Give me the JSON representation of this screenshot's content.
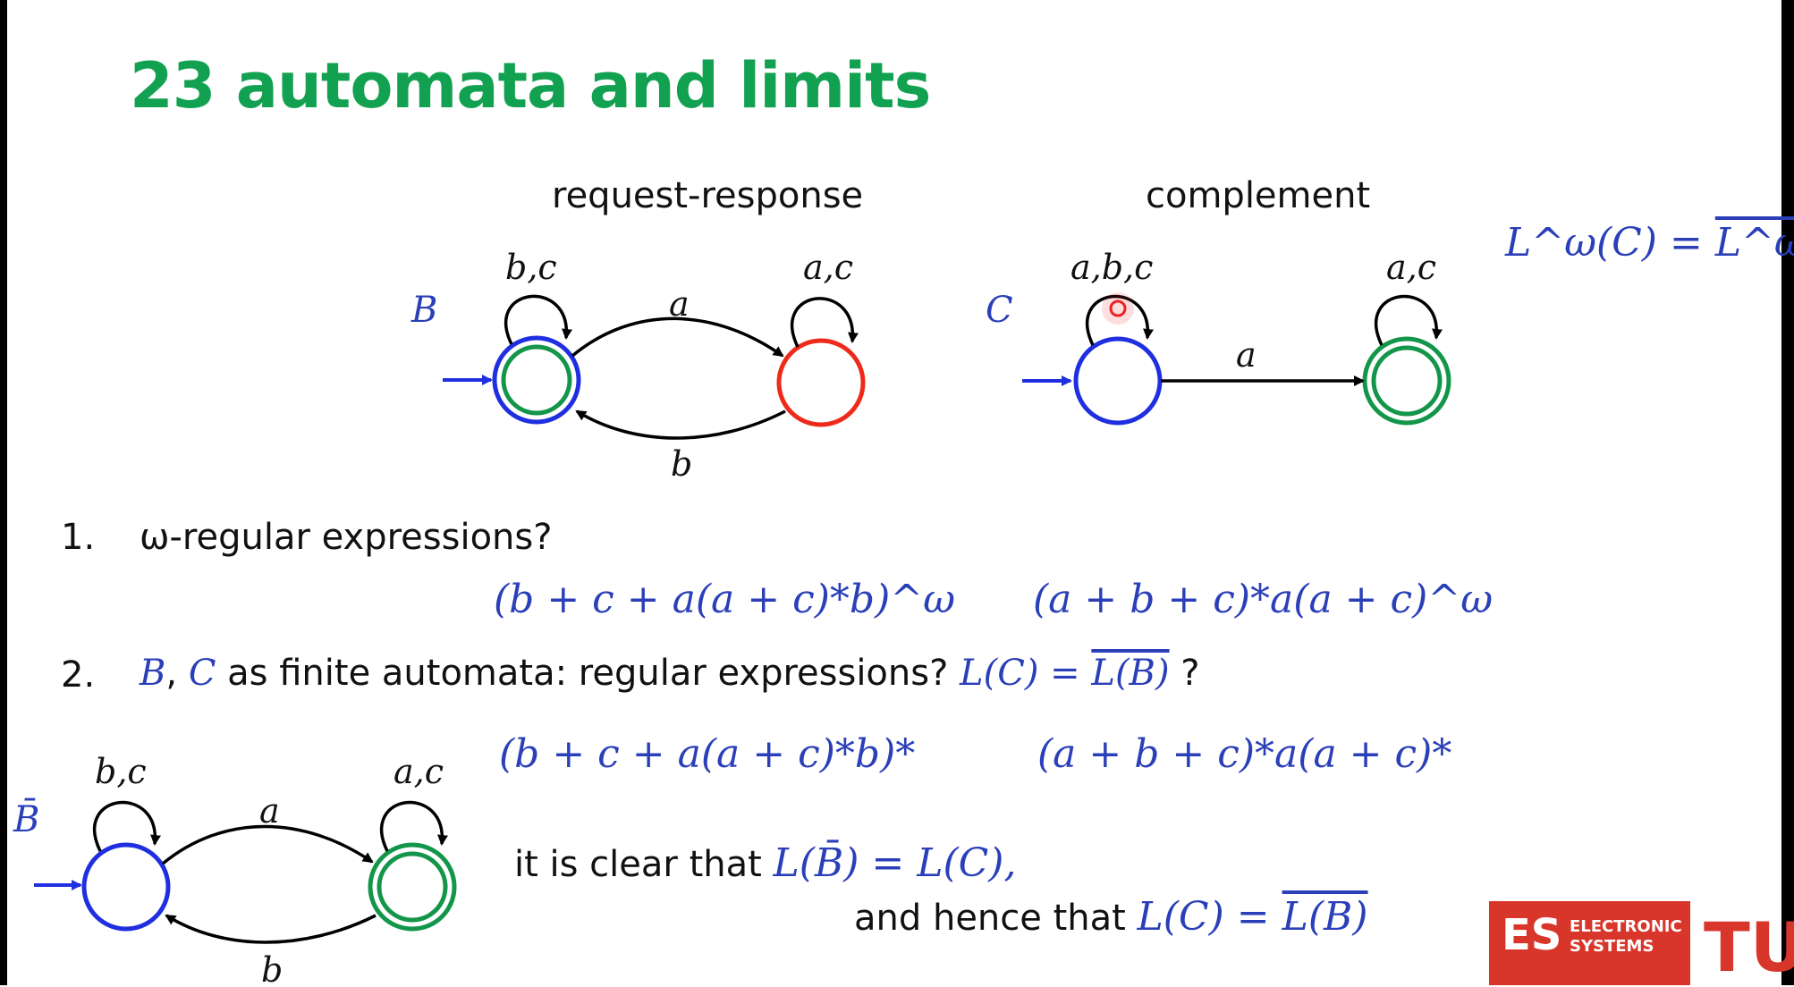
{
  "slide": {
    "title": "23 automata and limits",
    "heading_left": "request-response",
    "heading_right": "complement",
    "eq_top_right_lhs": "L^ω(C) = ",
    "eq_top_right_rhs": "L^ω(B)",
    "item1_number": "1.",
    "item1_text": "ω-regular expressions?",
    "expr1_left": "(b + c + a(a + c)*b)^ω",
    "expr1_right": "(a + b + c)*a(a + c)^ω",
    "item2_number": "2.",
    "item2_B": "B",
    "item2_comma": ", ",
    "item2_C": "C",
    "item2_text": " as finite automata: regular expressions? ",
    "item2_eq_lhs": "L(C) = ",
    "item2_eq_rhs": "L(B)",
    "item2_q": " ?",
    "expr2_left": "(b + c + a(a + c)*b)*",
    "expr2_right": "(a + b + c)*a(a + c)*",
    "clear_text": "it is clear that ",
    "clear_eq": "L(B̄) = L(C),",
    "hence_text": "and hence that ",
    "hence_eq_lhs": "L(C) = ",
    "hence_eq_rhs": "L(B)"
  },
  "automata": {
    "B": {
      "name": "B",
      "loop_left": "b,c",
      "loop_right": "a,c",
      "edge_top": "a",
      "edge_bottom": "b"
    },
    "C": {
      "name": "C",
      "loop_left": "a,b,c",
      "loop_right": "a,c",
      "edge": "a"
    },
    "Bbar": {
      "name": "B̄",
      "loop_left": "b,c",
      "loop_right": "a,c",
      "edge_top": "a",
      "edge_bottom": "b"
    }
  },
  "logo": {
    "es": "ES",
    "line1": "ELECTRONIC",
    "line2": "SYSTEMS",
    "tu": "TU"
  },
  "colors": {
    "title": "#12a150",
    "math": "#2a3fb8",
    "blue_state": "#1f2fe0",
    "red_state": "#ee2a1a",
    "green_state": "#13964a",
    "logo": "#d8362b"
  }
}
